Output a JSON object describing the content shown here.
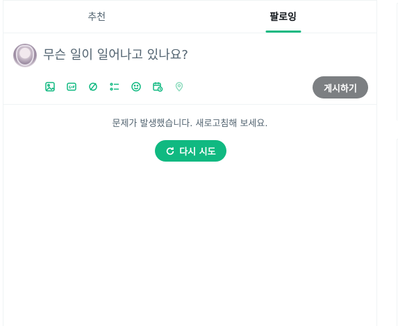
{
  "tabs": [
    {
      "label": "추천",
      "active": false
    },
    {
      "label": "팔로잉",
      "active": true
    }
  ],
  "composer": {
    "placeholder": "무슨 일이 일어나고 있나요?",
    "post_label": "게시하기",
    "tools": [
      "image-icon",
      "gif-icon",
      "grok-icon",
      "poll-icon",
      "emoji-icon",
      "schedule-icon",
      "location-icon"
    ]
  },
  "error": {
    "message": "문제가 발생했습니다. 새로고침해 보세요.",
    "retry_label": "다시 시도"
  },
  "colors": {
    "accent": "#10b981",
    "text_secondary": "#536471",
    "post_button": "#7c7f82",
    "border": "#eff3f4"
  }
}
